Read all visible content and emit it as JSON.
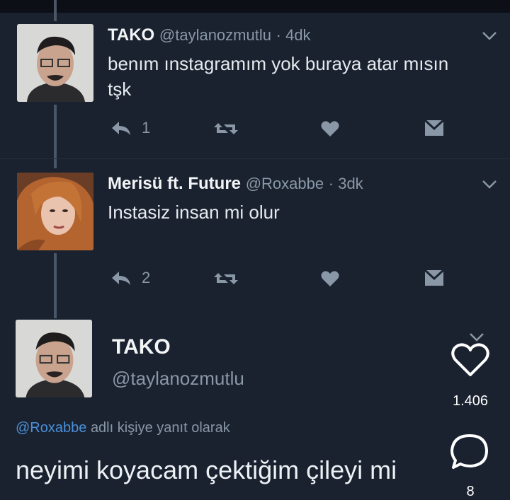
{
  "tweets": [
    {
      "name": "TAKO",
      "handle": "@taylanozmutlu",
      "time": "· 4dk",
      "text_line1": "benım ınstagramım yok buraya atar mısın",
      "text_line2": "tşk",
      "reply_count": "1"
    },
    {
      "name": "Merisü ft. Future",
      "handle": "@Roxabbe",
      "time": "· 3dk",
      "text_line1": "Instasiz insan mi olur",
      "reply_count": "2"
    }
  ],
  "main_tweet": {
    "name": "TAKO",
    "handle": "@taylanozmutlu",
    "reply_mention": "@Roxabbe",
    "reply_suffix": "adlı kişiye yanıt olarak",
    "text": "neyimi koyacam çektiğim çileyi mi"
  },
  "overlay": {
    "like_count": "1.406",
    "comment_count": "8"
  },
  "icons": [
    "reply-icon",
    "retweet-icon",
    "heart-icon",
    "dm-icon",
    "chevron-down-icon",
    "overlay-heart-icon",
    "overlay-comment-icon"
  ]
}
